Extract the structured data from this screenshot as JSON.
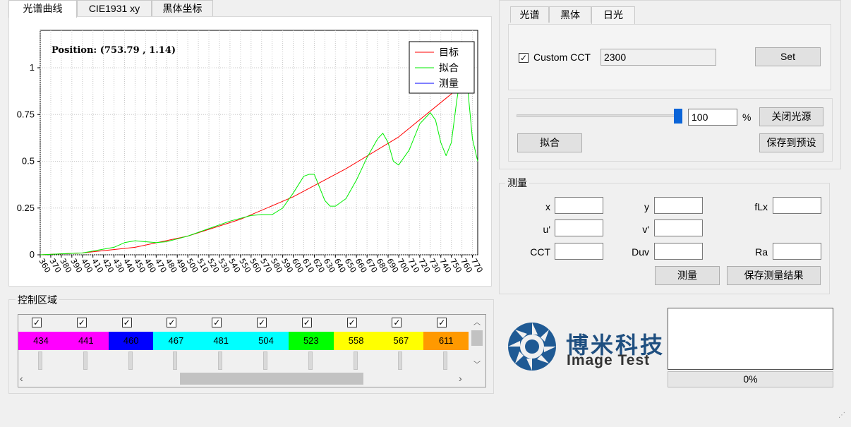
{
  "left_tabs": [
    {
      "label": "光谱曲线",
      "active": true
    },
    {
      "label": "CIE1931 xy",
      "active": false
    },
    {
      "label": "黑体坐标",
      "active": false
    }
  ],
  "chart_data": {
    "type": "line",
    "title": "",
    "annotation": "Position: (753.79 , 1.14)",
    "xlabel": "",
    "ylabel": "",
    "xlim": [
      360,
      775
    ],
    "ylim": [
      0,
      1.2
    ],
    "x_ticks": [
      360,
      370,
      380,
      390,
      400,
      410,
      420,
      430,
      440,
      450,
      460,
      470,
      480,
      490,
      500,
      510,
      520,
      530,
      540,
      550,
      560,
      570,
      580,
      590,
      600,
      610,
      620,
      630,
      640,
      650,
      660,
      670,
      680,
      690,
      700,
      710,
      720,
      730,
      740,
      750,
      760,
      770
    ],
    "y_ticks": [
      0,
      0.25,
      0.5,
      0.75,
      1
    ],
    "y_tick_labels": [
      "0",
      "0.25",
      "0.5",
      "0.75",
      "1"
    ],
    "grid": true,
    "legend_position": "top-right",
    "series": [
      {
        "name": "目标",
        "color": "#ff0000",
        "x": [
          360,
          400,
          450,
          500,
          550,
          600,
          650,
          700,
          750,
          770
        ],
        "y": [
          0,
          0.01,
          0.04,
          0.1,
          0.19,
          0.31,
          0.46,
          0.63,
          0.86,
          0.99
        ]
      },
      {
        "name": "拟合",
        "color": "#00ee00",
        "x": [
          360,
          400,
          430,
          440,
          450,
          460,
          470,
          480,
          500,
          520,
          540,
          560,
          570,
          580,
          590,
          600,
          610,
          615,
          620,
          625,
          630,
          635,
          640,
          650,
          660,
          670,
          680,
          685,
          690,
          695,
          700,
          710,
          720,
          730,
          735,
          740,
          745,
          750,
          755,
          760,
          765,
          770,
          775
        ],
        "y": [
          0,
          0.01,
          0.04,
          0.065,
          0.075,
          0.07,
          0.065,
          0.07,
          0.1,
          0.14,
          0.18,
          0.21,
          0.215,
          0.215,
          0.25,
          0.33,
          0.42,
          0.43,
          0.43,
          0.36,
          0.29,
          0.26,
          0.26,
          0.3,
          0.4,
          0.52,
          0.62,
          0.65,
          0.6,
          0.5,
          0.48,
          0.56,
          0.7,
          0.76,
          0.72,
          0.6,
          0.53,
          0.6,
          0.82,
          1.0,
          0.92,
          0.62,
          0.5
        ]
      },
      {
        "name": "测量",
        "color": "#0000ff",
        "x": [],
        "y": []
      }
    ]
  },
  "right_tabs": [
    {
      "label": "光谱",
      "active": false
    },
    {
      "label": "黑体",
      "active": false
    },
    {
      "label": "日光",
      "active": true
    }
  ],
  "custom_cct": {
    "label": "Custom CCT",
    "checked": true,
    "value": "2300",
    "set_label": "Set"
  },
  "source_control": {
    "slider_value": 100,
    "value": "100",
    "unit": "%",
    "close_label": "关闭光源",
    "fit_label": "拟合",
    "save_preset_label": "保存到预设"
  },
  "measurement": {
    "title": "测量",
    "fields": {
      "x": {
        "label": "x",
        "value": ""
      },
      "y": {
        "label": "y",
        "value": ""
      },
      "flx": {
        "label": "fLx",
        "value": ""
      },
      "u": {
        "label": "u'",
        "value": ""
      },
      "v": {
        "label": "v'",
        "value": ""
      },
      "cct": {
        "label": "CCT",
        "value": ""
      },
      "duv": {
        "label": "Duv",
        "value": ""
      },
      "ra": {
        "label": "Ra",
        "value": ""
      }
    },
    "measure_label": "测量",
    "save_label": "保存测量结果"
  },
  "control_area": {
    "title": "控制区域",
    "channels": [
      {
        "wavelength": "434",
        "color": "#ff00ff",
        "checked": true
      },
      {
        "wavelength": "441",
        "color": "#ff00ff",
        "checked": true
      },
      {
        "wavelength": "460",
        "color": "#0000ff",
        "checked": true
      },
      {
        "wavelength": "467",
        "color": "#00ffff",
        "checked": true
      },
      {
        "wavelength": "481",
        "color": "#00ffff",
        "checked": true
      },
      {
        "wavelength": "504",
        "color": "#00ffff",
        "checked": true
      },
      {
        "wavelength": "523",
        "color": "#00ff00",
        "checked": true
      },
      {
        "wavelength": "558",
        "color": "#ffff00",
        "checked": true
      },
      {
        "wavelength": "567",
        "color": "#ffff00",
        "checked": true
      },
      {
        "wavelength": "611",
        "color": "#ff9900",
        "checked": true
      }
    ]
  },
  "logo": {
    "cn": "博米科技",
    "en": "Image Test"
  },
  "progress": {
    "value": 0,
    "label": "0%"
  }
}
